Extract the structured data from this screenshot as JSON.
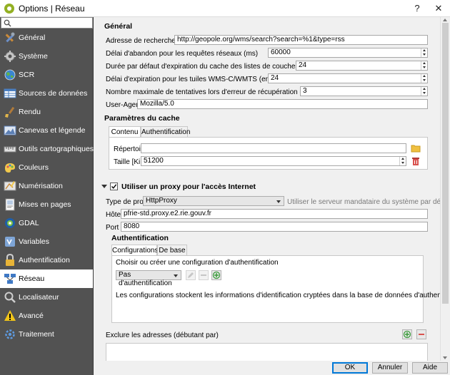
{
  "window": {
    "title": "Options | Réseau",
    "help_glyph": "?",
    "close_glyph": "✕"
  },
  "sidebar": {
    "items": [
      {
        "label": "Général",
        "icon": "tools-icon"
      },
      {
        "label": "Système",
        "icon": "gear-icon"
      },
      {
        "label": "SCR",
        "icon": "globe-icon"
      },
      {
        "label": "Sources de données",
        "icon": "table-icon"
      },
      {
        "label": "Rendu",
        "icon": "paintbrush-icon"
      },
      {
        "label": "Canevas et légende",
        "icon": "canvas-icon"
      },
      {
        "label": "Outils cartographiques",
        "icon": "ruler-icon"
      },
      {
        "label": "Couleurs",
        "icon": "palette-icon"
      },
      {
        "label": "Numérisation",
        "icon": "digitize-icon"
      },
      {
        "label": "Mises en pages",
        "icon": "layout-icon"
      },
      {
        "label": "GDAL",
        "icon": "gdal-icon"
      },
      {
        "label": "Variables",
        "icon": "variables-icon"
      },
      {
        "label": "Authentification",
        "icon": "lock-icon"
      },
      {
        "label": "Réseau",
        "icon": "network-icon",
        "active": true
      },
      {
        "label": "Localisateur",
        "icon": "search-icon"
      },
      {
        "label": "Avancé",
        "icon": "warning-icon"
      },
      {
        "label": "Traitement",
        "icon": "processing-icon"
      }
    ]
  },
  "general": {
    "title": "Général",
    "search_url_label": "Adresse de recherche WMS",
    "search_url_value": "http://geopole.org/wms/search?search=%1&type=rss",
    "timeout_label": "Délai d'abandon pour les requêtes réseaux (ms)",
    "timeout_value": "60000",
    "cache_duration_label": "Durée par défaut d'expiration du cache des listes de couches WMS (en heures)",
    "cache_duration_value": "24",
    "tile_expiry_label": "Délai d'expiration pour les tuiles WMS-C/WMTS (en heures)",
    "tile_expiry_value": "24",
    "max_retry_label": "Nombre maximale de tentatives lors d'erreur de récupération de tuile ou d'entités",
    "max_retry_value": "3",
    "user_agent_label": "User-Agent",
    "user_agent_value": "Mozilla/5.0"
  },
  "cache": {
    "title": "Paramètres du cache",
    "tab_content": "Contenu",
    "tab_auth": "Authentification",
    "directory_label": "Répertoire",
    "directory_value": "",
    "size_label": "Taille [KiB]",
    "size_value": "51200"
  },
  "proxy": {
    "title": "Utiliser un proxy pour l'accès Internet",
    "type_label": "Type de proxy",
    "type_value": "HttpProxy",
    "type_hint": "Utiliser le serveur mandataire du système par défaut",
    "host_label": "Hôte",
    "host_value": "pfrie-std.proxy.e2.rie.gouv.fr",
    "port_label": "Port",
    "port_value": "8080",
    "auth_title": "Authentification",
    "tab_configs": "Configurations",
    "tab_basic": "De base",
    "choose_text": "Choisir ou créer une configuration d'authentification",
    "auth_select_value": "Pas d'authentification",
    "info_text": "Les configurations stockent les informations d'identification cryptées dans la base de données d'authentification QGIS.",
    "exclude_label": "Exclure les adresses (débutant par)"
  },
  "buttons": {
    "ok": "OK",
    "cancel": "Annuler",
    "help": "Aide"
  },
  "colors": {
    "sidebar_bg": "#525252",
    "accent": "#0078d7",
    "qgis_green": "#93b023",
    "danger": "#d9534f"
  }
}
